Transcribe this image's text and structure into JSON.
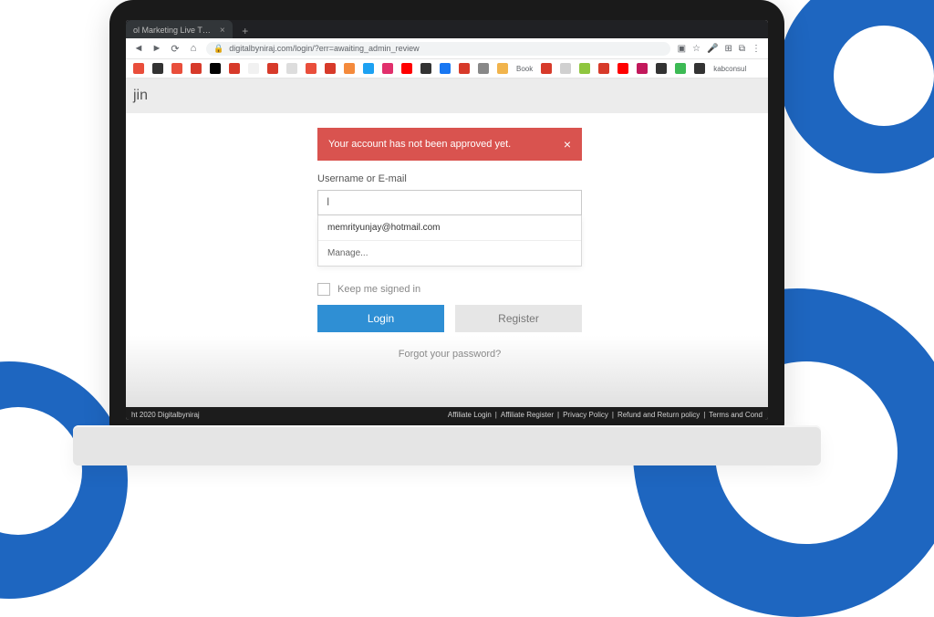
{
  "browser": {
    "tab_title": "ol Marketing Live T…",
    "url": "digitalbyniraj.com/login/?err=awaiting_admin_review",
    "bookmark_trailing_labels": [
      "Book",
      "kabconsul"
    ],
    "bookmark_colors": [
      "#e94e3b",
      "#333333",
      "#e94e3b",
      "#d73a2a",
      "#000000",
      "#d73a2a",
      "#f1f1f1",
      "#d73a2a",
      "#dddddd",
      "#e94e3b",
      "#d73a2a",
      "#f48a3c",
      "#1da1f2",
      "#e1306c",
      "#ff0000",
      "#333333",
      "#1877f2",
      "#d73a2a",
      "#888888",
      "#f1b44c",
      "#d73a2a",
      "#d0d0d0",
      "#8fc63f",
      "#d73a2a",
      "#ff0000",
      "#c2185b",
      "#333333",
      "#3cba54",
      "#333333"
    ]
  },
  "page": {
    "title_fragment": "jin",
    "alert_text": "Your account has not been approved yet.",
    "username_label": "Username or E-mail",
    "username_value": "",
    "autofill_suggestion": "memrityunjay@hotmail.com",
    "autofill_manage": "Manage...",
    "remember_label": "Keep me signed in",
    "login_btn": "Login",
    "register_btn": "Register",
    "forgot_link": "Forgot your password?",
    "footer_copyright": "ht 2020 Digitalbyniraj",
    "footer_links": [
      "Affiliate Login",
      "Affiliate Register",
      "Privacy Policy",
      "Refund and Return policy",
      "Terms and Cond"
    ]
  }
}
